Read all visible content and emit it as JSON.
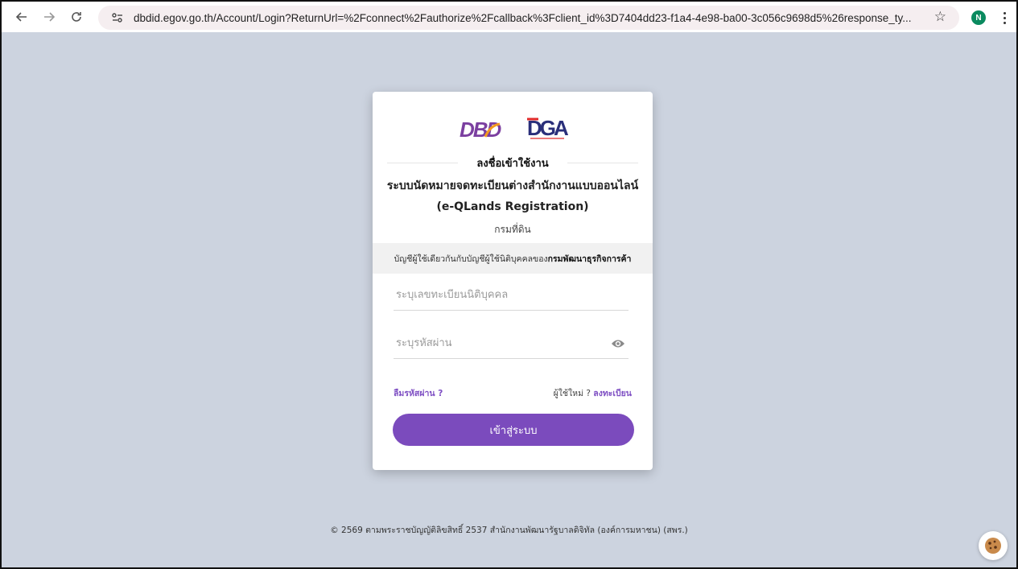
{
  "browser": {
    "url": "dbdid.egov.go.th/Account/Login?ReturnUrl=%2Fconnect%2Fauthorize%2Fcallback%3Fclient_id%3D7404dd23-f1a4-4e98-ba00-3c056c9698d5%26response_ty...",
    "profile_initial": "N"
  },
  "logos": {
    "dbd": "DBD",
    "dga": "DGA"
  },
  "login": {
    "heading": "ลงชื่อเข้าใช้งาน",
    "system_name": "ระบบนัดหมายจดทะเบียนต่างสำนักงานแบบออนไลน์ (e-QLands Registration)",
    "department": "กรมที่ดิน",
    "notice_prefix": "บัญชีผู้ใช้เดียวกันกับบัญชีผู้ใช้นิติบุคคลของ",
    "notice_bold": "กรมพัฒนาธุรกิจการค้า",
    "username_placeholder": "ระบุเลขทะเบียนนิติบุคคล",
    "password_placeholder": "ระบุรหัสผ่าน",
    "forgot_label": "ลืมรหัสผ่าน ?",
    "new_user_label": "ผู้ใช้ใหม่ ?",
    "register_label": "ลงทะเบียน",
    "submit_label": "เข้าสู่ระบบ"
  },
  "footer": {
    "text": "© 2569 ตามพระราชบัญญัติลิขสิทธิ์ 2537 สำนักงานพัฒนารัฐบาลดิจิทัล (องค์การมหาชน) (สพร.)"
  },
  "colors": {
    "background": "#ccd3df",
    "accent": "#7b4bbd",
    "link": "#7e4fc3"
  },
  "icons": [
    "back-arrow-icon",
    "forward-arrow-icon",
    "reload-icon",
    "site-info-icon",
    "bookmark-star-icon",
    "menu-dots-icon",
    "eye-icon",
    "cookie-icon"
  ]
}
